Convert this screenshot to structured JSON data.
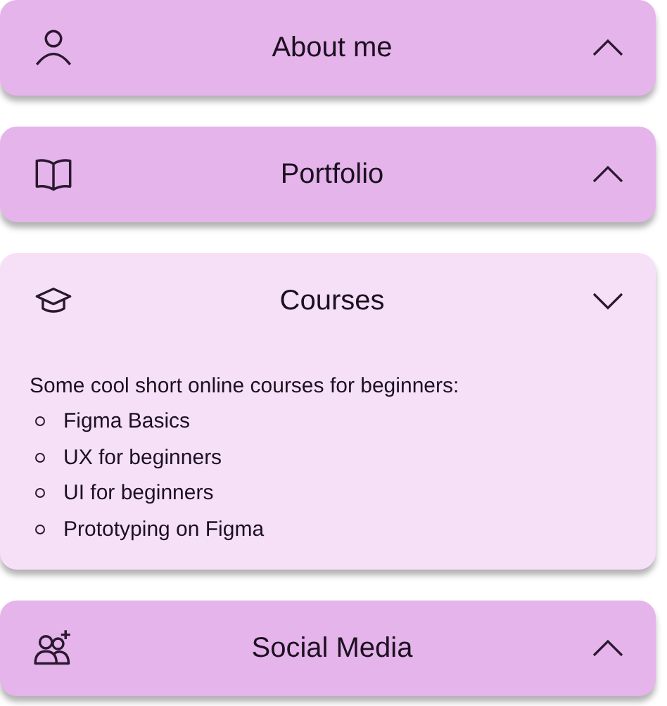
{
  "sections": [
    {
      "title": "About me",
      "expanded": false
    },
    {
      "title": "Portfolio",
      "expanded": false
    },
    {
      "title": "Courses",
      "expanded": true,
      "description": "Some cool short online courses for beginners:",
      "items": [
        "Figma Basics",
        "UX for beginners",
        "UI for beginners",
        "Prototyping on Figma"
      ]
    },
    {
      "title": "Social Media",
      "expanded": false
    }
  ]
}
